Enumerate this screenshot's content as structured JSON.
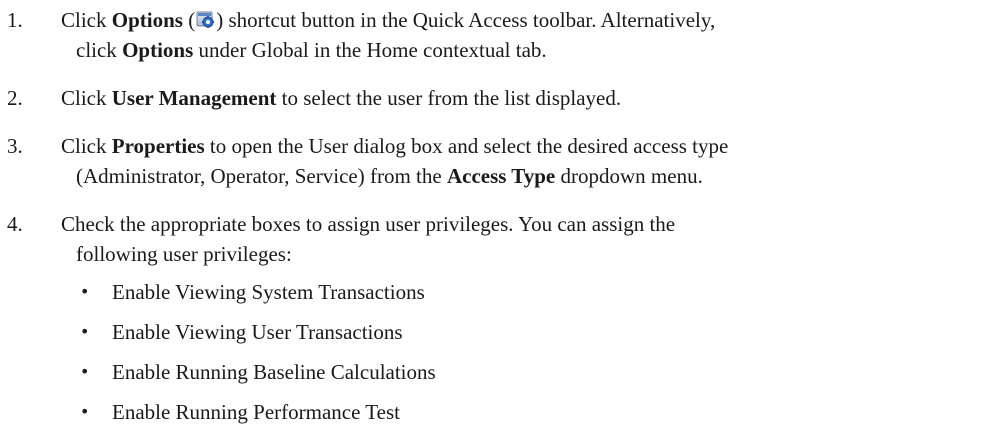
{
  "steps": [
    {
      "number": "1.",
      "pre": "Click ",
      "bold1": "Options",
      "after_icon_open": " (",
      "icon": "options-gear-icon",
      "after_icon_close": ") shortcut button in the Quick Access toolbar. Alternatively,",
      "line2_pre": "click ",
      "line2_bold": "Options",
      "line2_post": " under Global in the Home contextual tab."
    },
    {
      "number": "2.",
      "pre": "Click ",
      "bold1": "User Management",
      "post": " to select the user from the list displayed."
    },
    {
      "number": "3.",
      "pre": "Click ",
      "bold1": "Properties",
      "post": " to open the User dialog box and select the desired access type",
      "line2_pre": "(Administrator, Operator, Service) from the ",
      "line2_bold": "Access Type",
      "line2_post": " dropdown menu."
    },
    {
      "number": "4.",
      "line1": "Check the appropriate boxes to assign user privileges. You can assign the",
      "line2": "following user privileges:"
    }
  ],
  "privileges": [
    "Enable Viewing System Transactions",
    "Enable Viewing User Transactions",
    "Enable Running Baseline Calculations",
    "Enable Running Performance Test"
  ],
  "bullet_char": "•"
}
